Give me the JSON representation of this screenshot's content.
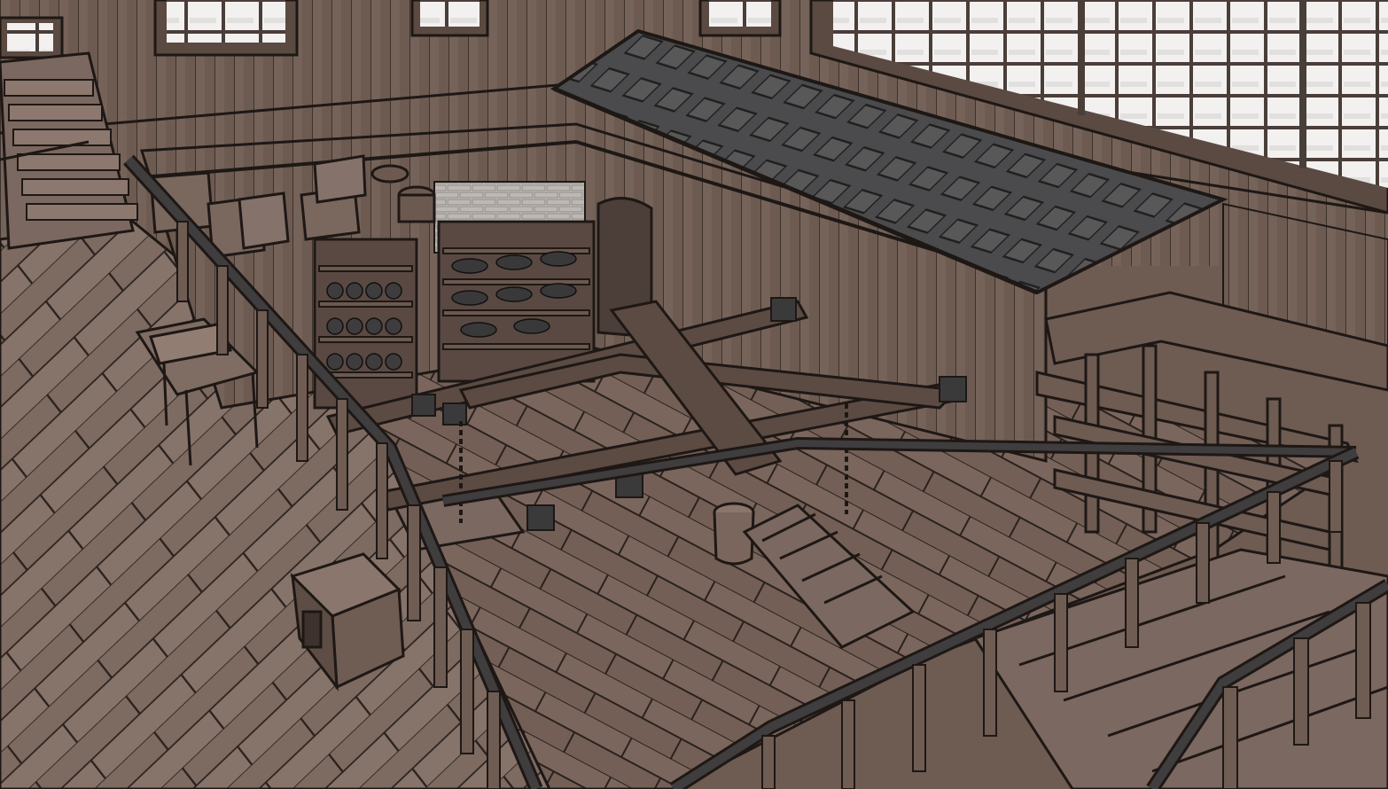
{
  "scene": {
    "kind": "3d-render-screenshot",
    "description_hidden": "",
    "palette": {
      "ink": "#1e1815",
      "floor_light": "#8a766d",
      "floor_dark": "#6f5c53",
      "wall": "#6a5950",
      "wall_light": "#85736a",
      "beam": "#5b4a42",
      "iron": "#3b3a3b",
      "roof": "#4a4a4c",
      "roof_tile": "#5c5c5e",
      "window_glass": "#f1f0ef",
      "window_frame": "#4b3f3a",
      "stone": "#b8b3ae"
    }
  }
}
